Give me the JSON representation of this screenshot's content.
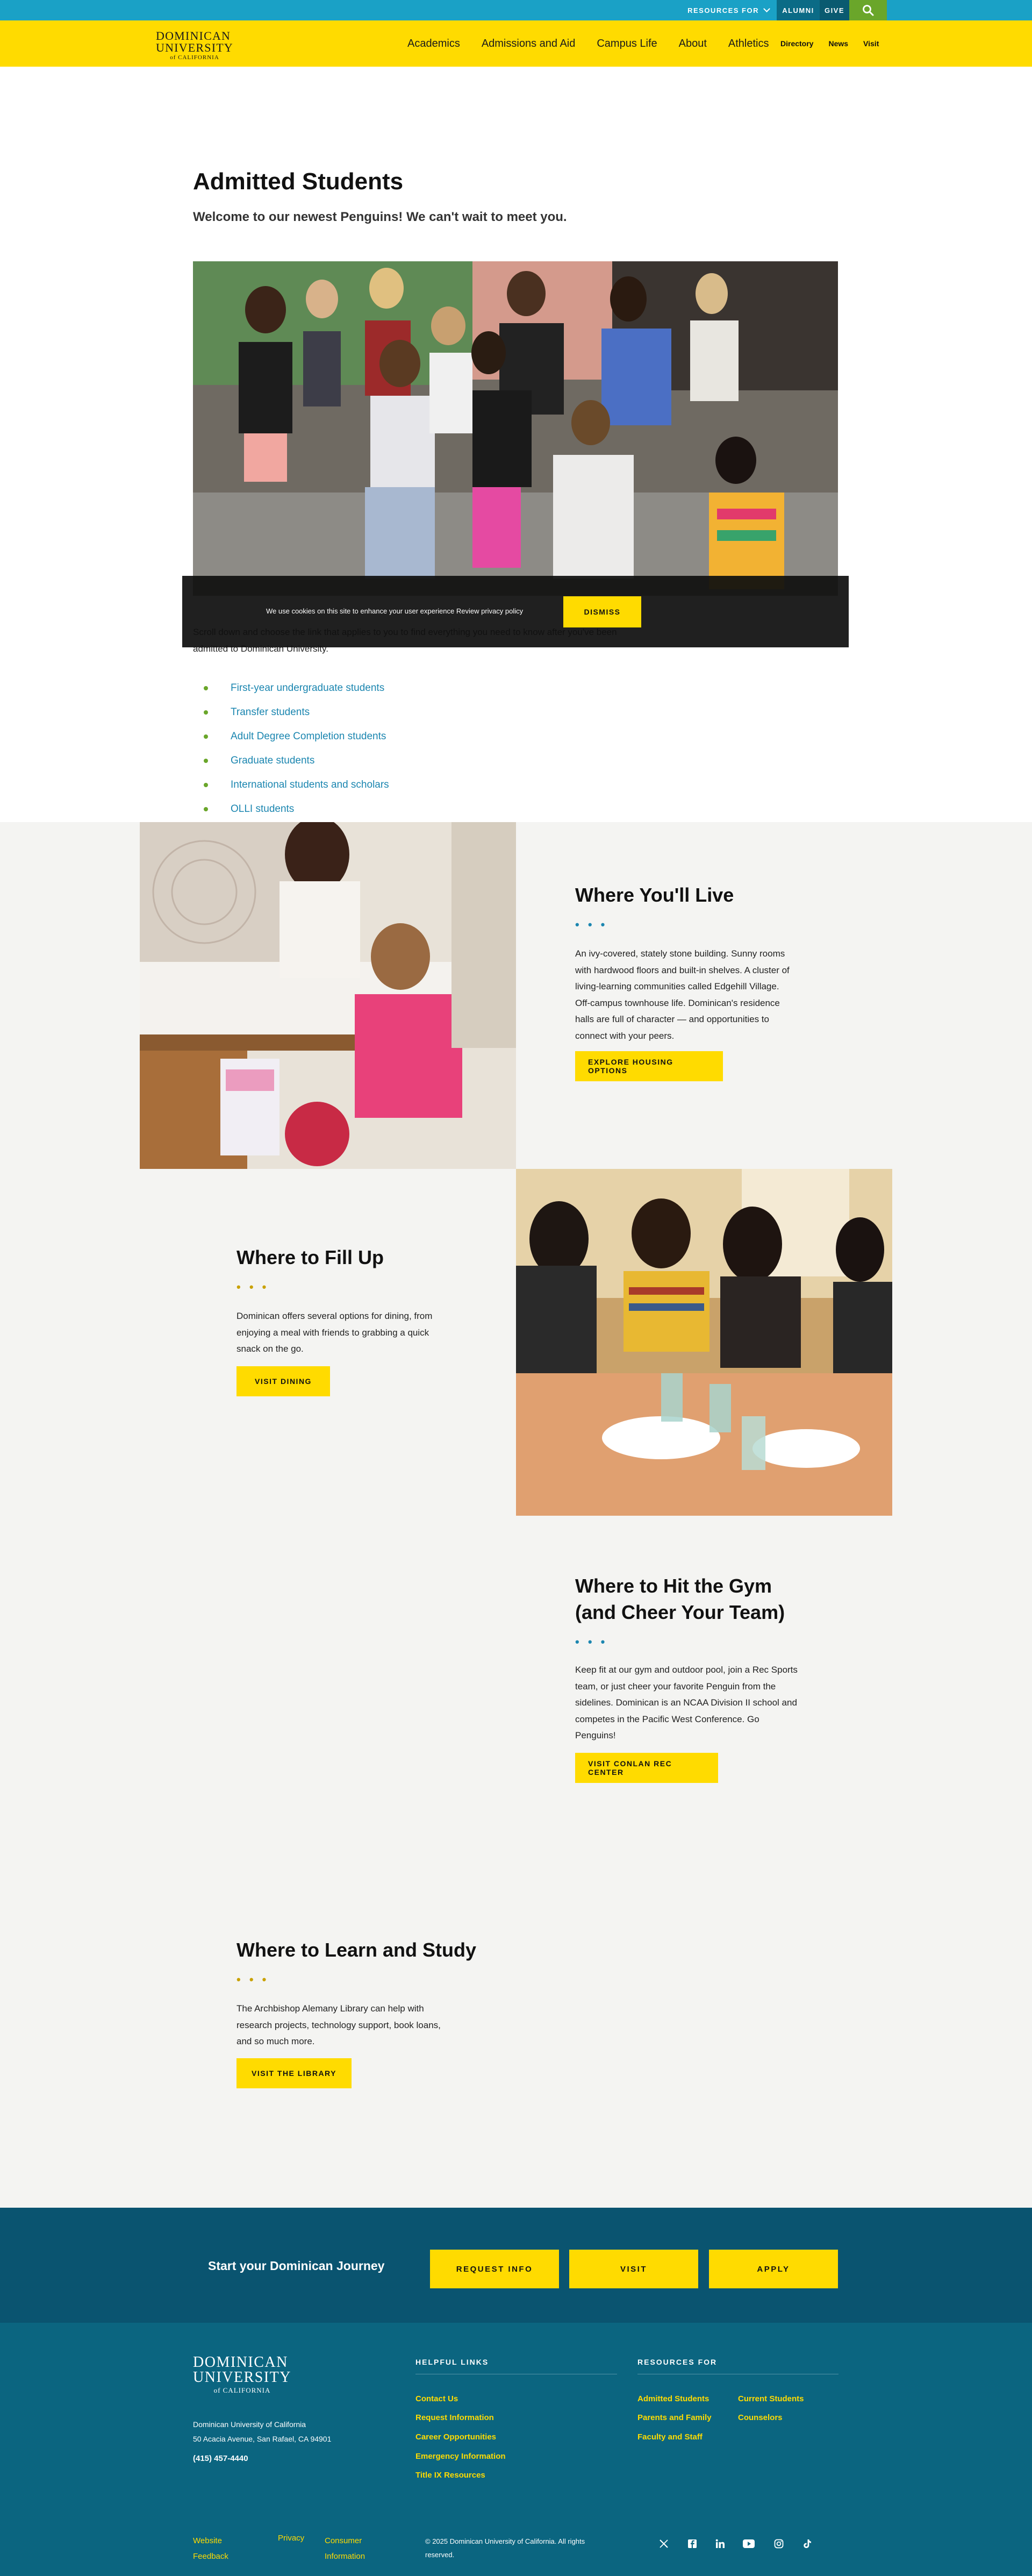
{
  "utility": {
    "resources_for": "RESOURCES FOR",
    "alumni": "ALUMNI",
    "give": "GIVE"
  },
  "logo": {
    "line1": "DOMINICAN",
    "line2": "UNIVERSITY",
    "line3": "of CALIFORNIA"
  },
  "nav": {
    "items": [
      "Academics",
      "Admissions and Aid",
      "Campus Life",
      "About",
      "Athletics"
    ],
    "secondary": [
      "Directory",
      "News",
      "Visit"
    ]
  },
  "intro": {
    "title": "Admitted Students",
    "welcome": "Welcome to our newest Penguins! We can't wait to meet you.",
    "text": "Scroll down and choose the link that applies to you to find everything you need to know after you've been admitted to Dominican University.",
    "links": [
      "First-year undergraduate students",
      "Transfer students",
      "Adult Degree Completion students",
      "Graduate students",
      "International students and scholars",
      "OLLI students"
    ]
  },
  "cookie": {
    "message": "We use cookies on this site to enhance your user experience Review privacy policy",
    "dismiss": "DISMISS"
  },
  "features": [
    {
      "title": "Where You'll Live",
      "dots": "• • •",
      "body": "An ivy-covered, stately stone building. Sunny rooms with hardwood floors and built-in shelves. A cluster of living-learning communities called Edgehill Village. Off-campus townhouse life. Dominican's residence halls are full of character — and opportunities to connect with your peers.",
      "button": "EXPLORE HOUSING OPTIONS"
    },
    {
      "title": "Where to Fill Up",
      "dots": "• • •",
      "body": "Dominican offers several options for dining, from enjoying a meal with friends to grabbing a quick snack on the go.",
      "button": "VISIT DINING"
    },
    {
      "title": "Where to Hit the Gym (and Cheer Your Team)",
      "dots": "• • •",
      "body": "Keep fit at our gym and outdoor pool, join a Rec Sports team, or just cheer your favorite Penguin from the sidelines. Dominican is an NCAA Division II school and competes in the Pacific West Conference. Go Penguins!",
      "button": "VISIT CONLAN REC CENTER"
    },
    {
      "title": "Where to Learn and Study",
      "dots": "• • •",
      "body": "The Archbishop Alemany Library can help with research projects, technology support, book loans, and so much more.",
      "button": "VISIT THE LIBRARY"
    }
  ],
  "journey": {
    "title": "Start your Dominican Journey",
    "buttons": [
      "REQUEST INFO",
      "VISIT",
      "APPLY"
    ]
  },
  "footer": {
    "address_name": "Dominican University of California",
    "address_street": "50 Acacia Avenue, San Rafael, CA 94901",
    "phone": "(415) 457-4440",
    "helpful_heading": "HELPFUL LINKS",
    "helpful_links": [
      "Contact Us",
      "Request Information",
      "Career Opportunities",
      "Emergency Information",
      "Title IX Resources"
    ],
    "resources_heading": "RESOURCES FOR",
    "resources_col1": [
      "Admitted Students",
      "Parents and Family",
      "Faculty and Staff"
    ],
    "resources_col2": [
      "Current Students",
      "Counselors"
    ],
    "bottom_links": [
      "Website Feedback",
      "Privacy",
      "Consumer Information"
    ],
    "copyright": "© 2025 Dominican University of California. All rights reserved."
  },
  "colors": {
    "yellow": "#ffdb00",
    "utility_blue": "#1aa1c6",
    "green": "#6aa62a",
    "dark_teal": "#0a5470",
    "footer_teal": "#0b6580",
    "link_blue": "#1b86b0"
  },
  "icons": {
    "search": "search-icon",
    "social": [
      "x-icon",
      "facebook-icon",
      "linkedin-icon",
      "youtube-icon",
      "instagram-icon",
      "tiktok-icon"
    ]
  }
}
